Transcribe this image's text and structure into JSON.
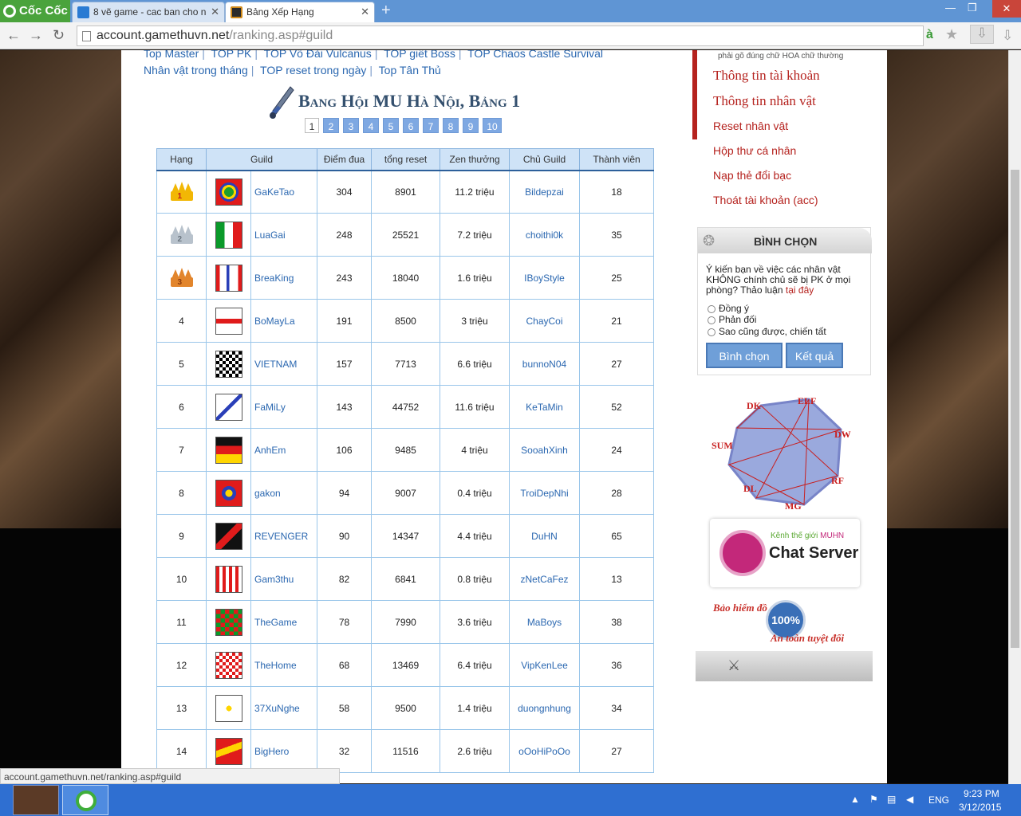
{
  "browser": {
    "brand": "Cốc Cốc",
    "tabs": [
      {
        "title": "8 vẽ game - cac ban cho n"
      },
      {
        "title": "Bảng Xếp Hạng"
      }
    ],
    "url_host": "account.gamethuvn.net",
    "url_path": "/ranking.asp#guild",
    "status_url": "account.gamethuvn.net/ranking.asp#guild"
  },
  "nav_links": {
    "row1": [
      "Top Master",
      "TOP PK",
      "TOP Võ Đài Vulcanus",
      "TOP giết Boss",
      "TOP Chaos Castle Survival"
    ],
    "row2": [
      "Nhân vật trong tháng",
      "TOP reset trong ngày",
      "Top Tân Thủ"
    ]
  },
  "heading": "Bang Hội MU Hà Nội, Bảng 1",
  "pager": [
    "1",
    "2",
    "3",
    "4",
    "5",
    "6",
    "7",
    "8",
    "9",
    "10"
  ],
  "table": {
    "headers": [
      "Hạng",
      "Guild",
      "Điểm đua",
      "tổng reset",
      "Zen thưởng",
      "Chủ Guild",
      "Thành viên"
    ],
    "rows": [
      {
        "rank": "1",
        "guild": "GaKeTao",
        "points": "304",
        "reset": "8901",
        "zen": "11.2 triệu",
        "owner": "Bildepzai",
        "members": "18"
      },
      {
        "rank": "2",
        "guild": "LuaGai",
        "points": "248",
        "reset": "25521",
        "zen": "7.2 triệu",
        "owner": "choithi0k",
        "members": "35"
      },
      {
        "rank": "3",
        "guild": "BreaKing",
        "points": "243",
        "reset": "18040",
        "zen": "1.6 triệu",
        "owner": "IBoyStyle",
        "members": "25"
      },
      {
        "rank": "4",
        "guild": "BoMayLa",
        "points": "191",
        "reset": "8500",
        "zen": "3 triệu",
        "owner": "ChayCoi",
        "members": "21"
      },
      {
        "rank": "5",
        "guild": "VIETNAM",
        "points": "157",
        "reset": "7713",
        "zen": "6.6 triệu",
        "owner": "bunnoN04",
        "members": "27"
      },
      {
        "rank": "6",
        "guild": "FaMiLy",
        "points": "143",
        "reset": "44752",
        "zen": "11.6 triệu",
        "owner": "KeTaMin",
        "members": "52"
      },
      {
        "rank": "7",
        "guild": "AnhEm",
        "points": "106",
        "reset": "9485",
        "zen": "4 triệu",
        "owner": "SooahXinh",
        "members": "24"
      },
      {
        "rank": "8",
        "guild": "gakon",
        "points": "94",
        "reset": "9007",
        "zen": "0.4 triệu",
        "owner": "TroiDepNhi",
        "members": "28"
      },
      {
        "rank": "9",
        "guild": "REVENGER",
        "points": "90",
        "reset": "14347",
        "zen": "4.4 triệu",
        "owner": "DuHN",
        "members": "65"
      },
      {
        "rank": "10",
        "guild": "Gam3thu",
        "points": "82",
        "reset": "6841",
        "zen": "0.8 triệu",
        "owner": "zNetCaFez",
        "members": "13"
      },
      {
        "rank": "11",
        "guild": "TheGame",
        "points": "78",
        "reset": "7990",
        "zen": "3.6 triệu",
        "owner": "MaBoys",
        "members": "38"
      },
      {
        "rank": "12",
        "guild": "TheHome",
        "points": "68",
        "reset": "13469",
        "zen": "6.4 triệu",
        "owner": "VipKenLee",
        "members": "36"
      },
      {
        "rank": "13",
        "guild": "37XuNghe",
        "points": "58",
        "reset": "9500",
        "zen": "1.4 triệu",
        "owner": "duongnhung",
        "members": "34"
      },
      {
        "rank": "14",
        "guild": "BigHero",
        "points": "32",
        "reset": "11516",
        "zen": "2.6 triệu",
        "owner": "oOoHiPoOo",
        "members": "27"
      }
    ]
  },
  "sidebar": {
    "note": "phải gõ đúng chữ HOA chữ thường",
    "menu": [
      "Thông tin tài khoản",
      "Thông tin nhân vật",
      "Reset nhân vật",
      "Hộp thư cá nhân",
      "Nạp thẻ đổi bạc",
      "Thoát tài khoản (acc)"
    ],
    "poll": {
      "title": "BÌNH CHỌN",
      "question": "Ý kiến bạn về việc các nhân vật KHÔNG chính chủ sẽ bị PK ở mọi phòng? Thảo luận",
      "question_link": "tại đây",
      "options": [
        "Đồng ý",
        "Phản đối",
        "Sao cũng được, chiến tất"
      ],
      "vote_button": "Bình chọn",
      "result_button": "Kết quả"
    },
    "diagram_labels": [
      "DK",
      "ELF",
      "DW",
      "RF",
      "MG",
      "DL",
      "SUM"
    ],
    "chat": {
      "sub": "Kênh thế giới",
      "brand": "MUHN",
      "title": "Chat Server"
    },
    "insurance": {
      "top": "Bảo hiểm đồ",
      "pct": "100%",
      "bottom": "An toàn tuyệt đối"
    }
  },
  "taskbar": {
    "lang": "ENG",
    "time": "9:23 PM",
    "date": "3/12/2015"
  },
  "colors": {
    "link": "#2a67b0",
    "menu": "#b5221e",
    "header_bg": "#cfe3f7",
    "taskbar": "#2f6fd1"
  }
}
